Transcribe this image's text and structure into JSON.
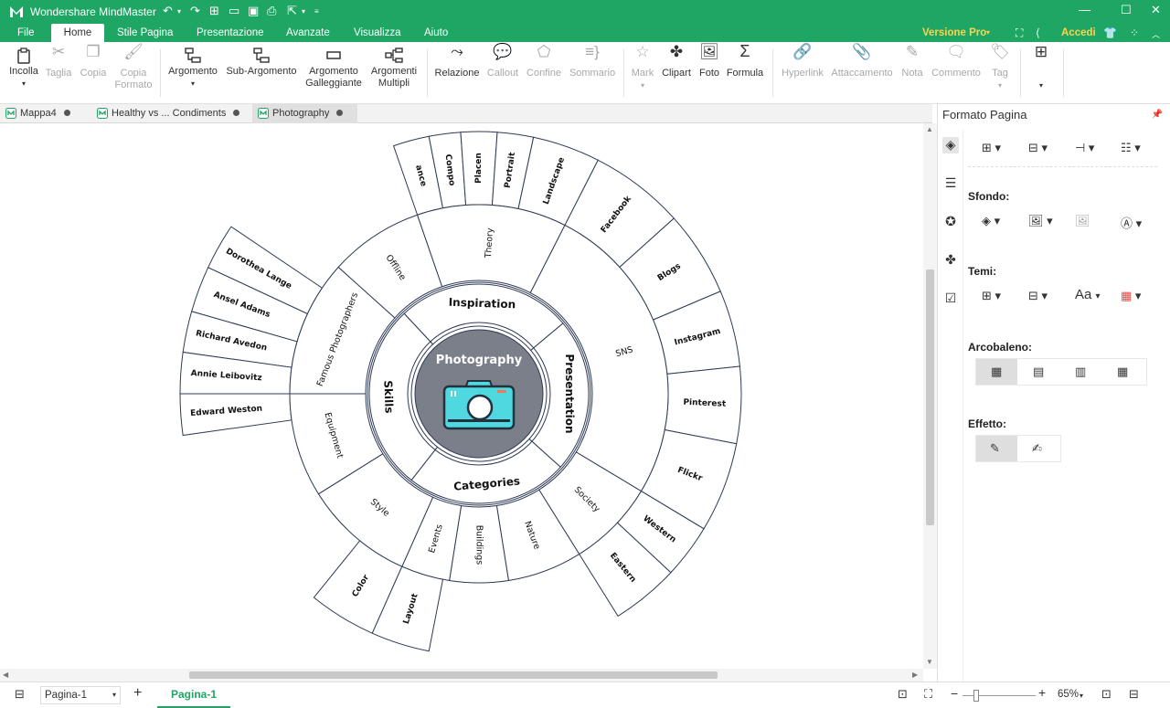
{
  "app": {
    "title": "Wondershare MindMaster"
  },
  "menu": {
    "items": [
      "File",
      "Home",
      "Stile Pagina",
      "Presentazione",
      "Avanzate",
      "Visualizza",
      "Aiuto"
    ],
    "pro": "Versione Pro",
    "login": "Accedi"
  },
  "ribbon": {
    "paste": "Incolla",
    "cut": "Taglia",
    "copy": "Copia",
    "format_copy_1": "Copia",
    "format_copy_2": "Formato",
    "topic": "Argomento",
    "subtopic": "Sub-Argomento",
    "floating_1": "Argomento",
    "floating_2": "Galleggiante",
    "multi_1": "Argomenti",
    "multi_2": "Multipli",
    "relation": "Relazione",
    "callout": "Callout",
    "boundary": "Confine",
    "summary": "Sommario",
    "mark": "Mark",
    "clipart": "Clipart",
    "photo": "Foto",
    "formula": "Formula",
    "hyperlink": "Hyperlink",
    "attachment": "Attaccamento",
    "note": "Nota",
    "comment": "Commento",
    "tag": "Tag"
  },
  "tabs": [
    {
      "label": "Mappa4"
    },
    {
      "label": "Healthy vs ... Condiments"
    },
    {
      "label": "Photography"
    }
  ],
  "map": {
    "center": "Photography",
    "main": [
      "Inspiration",
      "Presentation",
      "Categories",
      "Skills"
    ],
    "level2": [
      "Offline",
      "Theory",
      "SNS",
      "Society",
      "Nature",
      "Buildings",
      "Events",
      "Style",
      "Equipment",
      "Famous Photographers"
    ],
    "level3": [
      "ance",
      "Compo",
      "Placen",
      "Portrait",
      "Landscape",
      "Facebook",
      "Blogs",
      "Instagram",
      "Pinterest",
      "Flickr",
      "Western",
      "Eastern",
      "Color",
      "Layout",
      "Dorothea Lange",
      "Ansel Adams",
      "Richard Avedon",
      "Annie Leibovitz",
      "Edward Weston"
    ]
  },
  "panel": {
    "title": "Formato Pagina",
    "background": "Sfondo:",
    "themes": "Temi:",
    "rainbow": "Arcobaleno:",
    "effect": "Effetto:",
    "font_glyph": "Aa"
  },
  "status": {
    "page_select": "Pagina-1",
    "sheet_tab": "Pagina-1",
    "zoom": "65%"
  },
  "colors": {
    "brand": "#1fa664",
    "pro": "#ffd24a",
    "center_fill": "#7b7f8a",
    "camera": "#4fd8df",
    "line": "#2e3a55"
  }
}
